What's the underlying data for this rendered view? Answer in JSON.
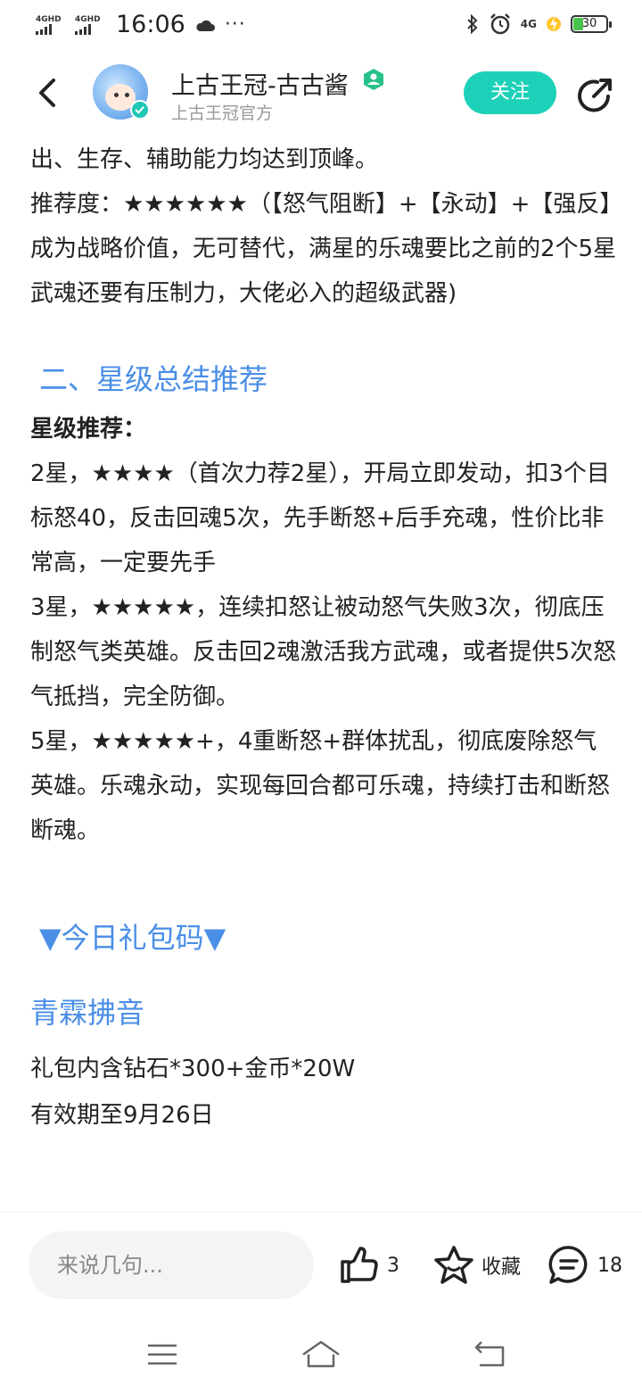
{
  "status_bar": {
    "signal_1_label": "4GHD",
    "signal_2_label": "4GHD",
    "time": "16:06",
    "more": "···",
    "network_right": "4G",
    "battery_level": "30"
  },
  "header": {
    "author_name": "上古王冠-古古酱",
    "author_subtitle": "上古王冠官方",
    "follow_label": "关注"
  },
  "article": {
    "p1": "出、生存、辅助能力均达到顶峰。",
    "p2": "推荐度：★★★★★★（【怒气阻断】+【永动】+【强反】成为战略价值，无可替代，满星的乐魂要比之前的2个5星武魂还要有压制力，大佬必入的超级武器)",
    "section_title": "二、星级总结推荐",
    "star_rec_label": "星级推荐：",
    "star2": "2星，★★★★（首次力荐2星），开局立即发动，扣3个目标怒40，反击回魂5次，先手断怒+后手充魂，性价比非常高，一定要先手",
    "star3": "3星，★★★★★，连续扣怒让被动怒气失败3次，彻底压制怒气类英雄。反击回2魂激活我方武魂，或者提供5次怒气抵挡，完全防御。",
    "star5": "5星，★★★★★+，4重断怒+群体扰乱，彻底废除怒气英雄。乐魂永动，实现每回合都可乐魂，持续打击和断怒断魂。",
    "gift_title": "▼今日礼包码▼",
    "gift_code": "青霖拂音",
    "gift_content": "礼包内含钻石*300+金币*20W",
    "gift_expiry": "有效期至9月26日"
  },
  "bottom_bar": {
    "comment_placeholder": "来说几句...",
    "like_count": "3",
    "favorite_label": "收藏",
    "comment_count": "18"
  },
  "colors": {
    "accent_blue": "#4a8ee6",
    "follow_green": "#1dd1b8",
    "battery_green": "#46c34a"
  }
}
